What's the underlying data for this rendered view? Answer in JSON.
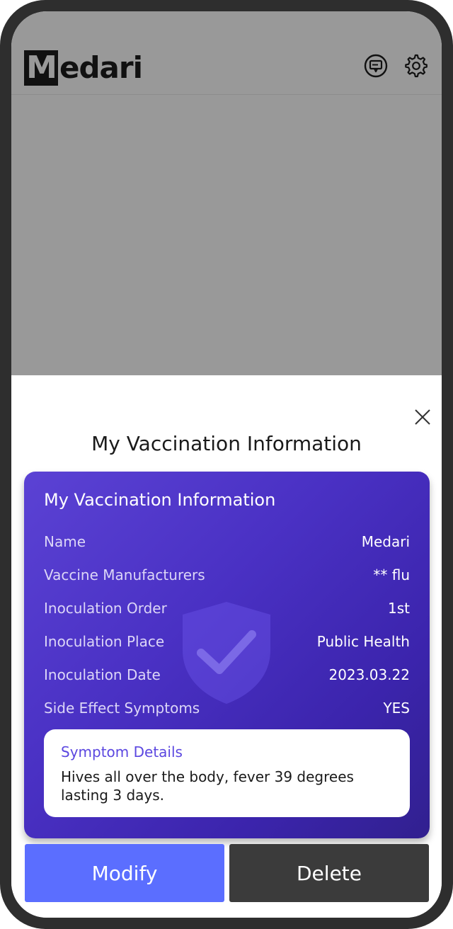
{
  "app": {
    "logo_initial": "M",
    "logo_rest": "edari",
    "chat_icon": "chat-bubble-icon",
    "settings_icon": "gear-icon"
  },
  "sheet": {
    "title": "My Vaccination Information",
    "close_icon": "close-icon"
  },
  "card": {
    "title": "My Vaccination Information",
    "rows": [
      {
        "label": "Name",
        "value": "Medari"
      },
      {
        "label": "Vaccine Manufacturers",
        "value": "** flu"
      },
      {
        "label": "Inoculation Order",
        "value": "1st"
      },
      {
        "label": "Inoculation Place",
        "value": "Public Health"
      },
      {
        "label": "Inoculation Date",
        "value": "2023.03.22"
      },
      {
        "label": "Side Effect Symptoms",
        "value": "YES"
      }
    ],
    "symptom": {
      "title": "Symptom Details",
      "text": "Hives all over the body, fever 39 degrees lasting 3 days."
    }
  },
  "actions": {
    "modify_label": "Modify",
    "delete_label": "Delete"
  },
  "colors": {
    "card_gradient_start": "#5b42d4",
    "card_gradient_end": "#31208f",
    "modify_button": "#5b6eff",
    "delete_button": "#3b3b3b",
    "symptom_title": "#5b47e0",
    "dim_overlay": "#999999"
  }
}
